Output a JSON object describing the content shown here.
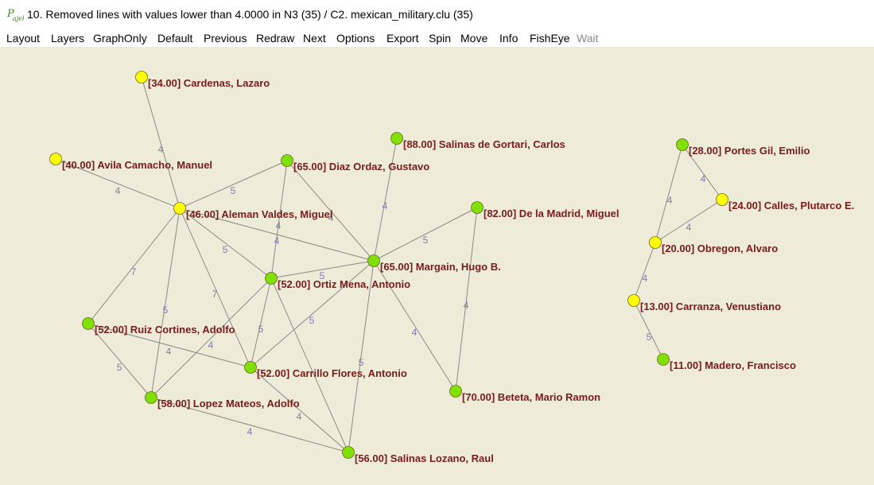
{
  "window": {
    "title": "10. Removed lines with values lower than 4.0000 in N3 (35) / C2. mexican_military.clu (35)"
  },
  "menu": [
    {
      "label": "Layout",
      "enabled": true
    },
    {
      "label": "Layers",
      "enabled": true
    },
    {
      "label": "GraphOnly",
      "enabled": true
    },
    {
      "label": "Default",
      "enabled": true
    },
    {
      "label": "Previous",
      "enabled": true
    },
    {
      "label": "Redraw",
      "enabled": true
    },
    {
      "label": "Next",
      "enabled": true
    },
    {
      "label": "Options",
      "enabled": true
    },
    {
      "label": "Export",
      "enabled": true
    },
    {
      "label": "Spin",
      "enabled": true
    },
    {
      "label": "Move",
      "enabled": true
    },
    {
      "label": "Info",
      "enabled": true
    },
    {
      "label": "FishEye",
      "enabled": true
    },
    {
      "label": "Wait",
      "enabled": false
    }
  ],
  "colors": {
    "canvas_bg": "#efebd9",
    "node_yellow": "#ffff00",
    "node_green": "#80e000",
    "label_color": "#7a1b1b",
    "edge_label_color": "#7b7bc0",
    "edge_color": "#8a8a8a"
  },
  "graph": {
    "nodes": [
      {
        "id": "cardenas",
        "label": "[34.00] Cardenas, Lazaro",
        "color": "yellow"
      },
      {
        "id": "avila",
        "label": "[40.00] Avila Camacho, Manuel",
        "color": "yellow"
      },
      {
        "id": "aleman",
        "label": "[46.00] Aleman Valdes, Miguel",
        "color": "yellow"
      },
      {
        "id": "diaz",
        "label": "[65.00] Diaz Ordaz, Gustavo",
        "color": "green"
      },
      {
        "id": "salinas_g",
        "label": "[88.00] Salinas de Gortari, Carlos",
        "color": "green"
      },
      {
        "id": "delamadrid",
        "label": "[82.00] De la Madrid, Miguel",
        "color": "green"
      },
      {
        "id": "margain",
        "label": "[65.00] Margain, Hugo B.",
        "color": "green"
      },
      {
        "id": "ortiz",
        "label": "[52.00] Ortiz Mena, Antonio",
        "color": "green"
      },
      {
        "id": "ruiz",
        "label": "[52.00] Ruiz Cortines, Adolfo",
        "color": "green"
      },
      {
        "id": "carrillo",
        "label": "[52.00] Carrillo Flores, Antonio",
        "color": "green"
      },
      {
        "id": "lopez",
        "label": "[58.00] Lopez Mateos, Adolfo",
        "color": "green"
      },
      {
        "id": "beteta",
        "label": "[70.00] Beteta, Mario Ramon",
        "color": "green"
      },
      {
        "id": "salinas_l",
        "label": "[56.00] Salinas Lozano, Raul",
        "color": "green"
      },
      {
        "id": "portes",
        "label": "[28.00] Portes Gil, Emilio",
        "color": "green"
      },
      {
        "id": "calles",
        "label": "[24.00] Calles, Plutarco E.",
        "color": "yellow"
      },
      {
        "id": "obregon",
        "label": "[20.00] Obregon, Alvaro",
        "color": "yellow"
      },
      {
        "id": "carranza",
        "label": "[13.00] Carranza, Venustiano",
        "color": "yellow"
      },
      {
        "id": "madero",
        "label": "[11.00] Madero, Francisco",
        "color": "green"
      }
    ],
    "edges": [
      {
        "from": "cardenas",
        "to": "aleman",
        "value": "4"
      },
      {
        "from": "avila",
        "to": "aleman",
        "value": "4"
      },
      {
        "from": "aleman",
        "to": "diaz",
        "value": "5"
      },
      {
        "from": "aleman",
        "to": "ortiz",
        "value": "5"
      },
      {
        "from": "aleman",
        "to": "margain",
        "value": "4"
      },
      {
        "from": "aleman",
        "to": "ruiz",
        "value": "7"
      },
      {
        "from": "aleman",
        "to": "lopez",
        "value": "5"
      },
      {
        "from": "aleman",
        "to": "carrillo",
        "value": "7"
      },
      {
        "from": "diaz",
        "to": "ortiz",
        "value": "4"
      },
      {
        "from": "diaz",
        "to": "margain",
        "value": "4"
      },
      {
        "from": "salinas_g",
        "to": "margain",
        "value": "4"
      },
      {
        "from": "delamadrid",
        "to": "margain",
        "value": "5"
      },
      {
        "from": "delamadrid",
        "to": "beteta",
        "value": "4"
      },
      {
        "from": "margain",
        "to": "ortiz",
        "value": "5"
      },
      {
        "from": "margain",
        "to": "carrillo",
        "value": "5"
      },
      {
        "from": "margain",
        "to": "beteta",
        "value": "4"
      },
      {
        "from": "margain",
        "to": "salinas_l",
        "value": "5"
      },
      {
        "from": "ortiz",
        "to": "carrillo",
        "value": "5"
      },
      {
        "from": "ortiz",
        "to": "lopez",
        "value": "4"
      },
      {
        "from": "ortiz",
        "to": "salinas_l",
        "value": ""
      },
      {
        "from": "ruiz",
        "to": "carrillo",
        "value": "4"
      },
      {
        "from": "ruiz",
        "to": "lopez",
        "value": "5"
      },
      {
        "from": "carrillo",
        "to": "salinas_l",
        "value": "4"
      },
      {
        "from": "lopez",
        "to": "salinas_l",
        "value": "4"
      },
      {
        "from": "portes",
        "to": "calles",
        "value": "4"
      },
      {
        "from": "portes",
        "to": "obregon",
        "value": "4"
      },
      {
        "from": "calles",
        "to": "obregon",
        "value": "4"
      },
      {
        "from": "obregon",
        "to": "carranza",
        "value": "4"
      },
      {
        "from": "carranza",
        "to": "madero",
        "value": "5"
      }
    ]
  }
}
